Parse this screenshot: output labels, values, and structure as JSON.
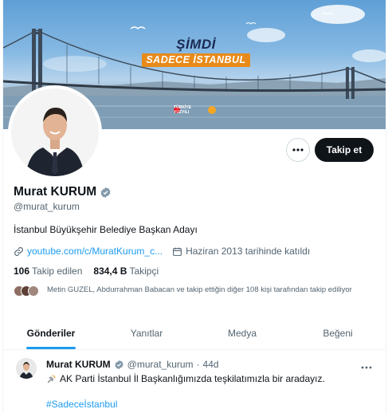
{
  "banner": {
    "title": "ŞİMDİ İSTANBUL",
    "subtitle": "SADECE İSTANBUL",
    "logo_text": "TÜRKİYE YÜZYILI"
  },
  "profile": {
    "name": "Murat KURUM",
    "handle": "@murat_kurum",
    "bio": "İstanbul Büyükşehir Belediye Başkan Adayı",
    "link": "youtube.com/c/MuratKurum_c...",
    "joined": "Haziran 2013 tarihinde katıldı",
    "following_count": "106",
    "following_label": "Takip edilen",
    "followers_count": "834,4 B",
    "followers_label": "Takipçi",
    "known_followers_text": "Metin GUZEL, Abdurrahman Babacan ve takip ettiğin diğer 108 kişi tarafından takip ediliyor"
  },
  "actions": {
    "follow_label": "Takip et"
  },
  "tabs": [
    {
      "label": "Gönderiler"
    },
    {
      "label": "Yanıtlar"
    },
    {
      "label": "Medya"
    },
    {
      "label": "Beğeni"
    }
  ],
  "post": {
    "name": "Murat KURUM",
    "handle": "@murat_kurum",
    "separator": "·",
    "time": "44d",
    "text": "AK Parti İstanbul İl Başkanlığımızda teşkilatımızla bir aradayız.",
    "hashtag": "#Sadeceİstanbul"
  },
  "colors": {
    "accent": "#1d9bf0",
    "text_primary": "#0f1419",
    "text_secondary": "#536471",
    "banner_orange": "#e88a1a"
  }
}
